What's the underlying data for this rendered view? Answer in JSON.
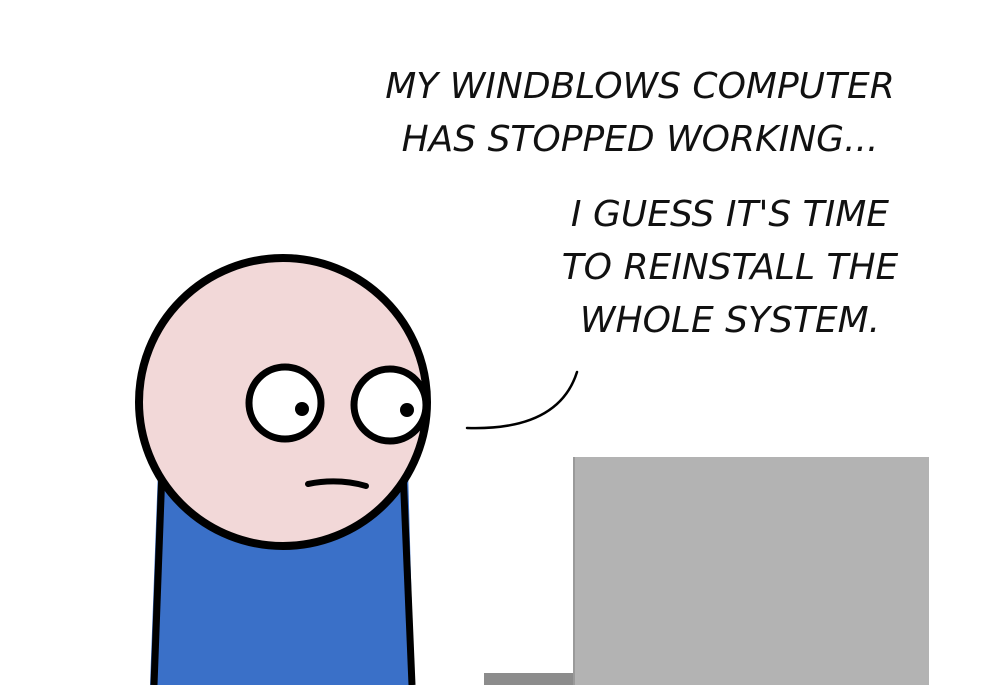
{
  "comic": {
    "speech_1": "MY WINDBLOWS COMPUTER\nHAS STOPPED WORKING...",
    "speech_2": "I GUESS IT'S TIME\nTO REINSTALL THE\nWHOLE SYSTEM.",
    "colors": {
      "background": "#ffffff",
      "outline": "#000000",
      "skin": "#f2d8d8",
      "shirt": "#3a70c8",
      "monitor": "#b3b3b3",
      "monitor_base": "#8c8c8c"
    },
    "icons": [
      "stick-figure",
      "computer-monitor",
      "speech-tail"
    ]
  }
}
